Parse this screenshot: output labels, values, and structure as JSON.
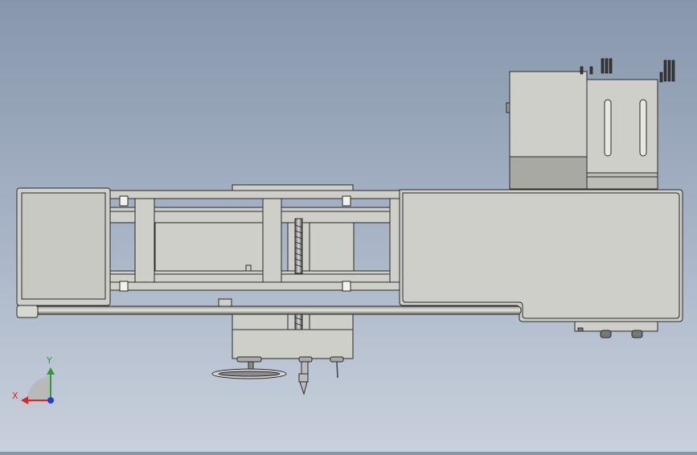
{
  "view": {
    "type": "CAD orthographic view",
    "background": [
      "#8796ab",
      "#c8d0dc"
    ],
    "part_fill": "#cfcfc9",
    "part_stroke": "#2a2a2a"
  },
  "triad": {
    "x_label": "X",
    "y_label": "Y",
    "x_color": "#d8282a",
    "y_color": "#2f9a36",
    "z_color": "#2a3ad0"
  }
}
